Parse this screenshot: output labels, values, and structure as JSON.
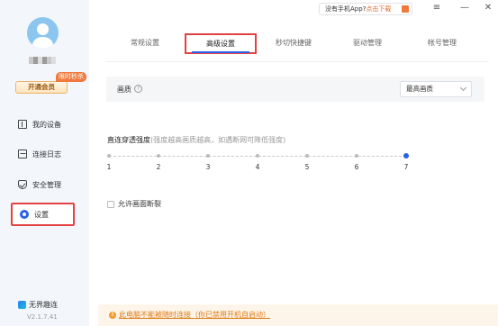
{
  "window": {
    "promo_text": "没有手机App?",
    "promo_link": "点击下载",
    "menu_icon": "≡",
    "minimize_icon": "—",
    "close_icon": "✕"
  },
  "sidebar": {
    "vip_button": "开通会员",
    "flash_badge": "限时秒杀",
    "items": [
      {
        "label": "我的设备",
        "icon": "device-icon"
      },
      {
        "label": "连接日志",
        "icon": "log-icon"
      },
      {
        "label": "安全管理",
        "icon": "shield-icon"
      },
      {
        "label": "设置",
        "icon": "gear-icon",
        "active": true
      }
    ],
    "brand": "无界趣连",
    "version": "V2.1.7.41"
  },
  "tabs": [
    {
      "label": "常规设置"
    },
    {
      "label": "高级设置",
      "active": true
    },
    {
      "label": "秒切快捷键"
    },
    {
      "label": "驱动管理"
    },
    {
      "label": "帐号管理"
    }
  ],
  "quality": {
    "label": "画质",
    "help_icon": "?",
    "selected": "最高画质"
  },
  "penetration": {
    "label": "直连穿透强度",
    "hint": "(强度越高画质越高，如遇断网可降低强度)",
    "ticks": [
      "1",
      "2",
      "3",
      "4",
      "5",
      "6",
      "7"
    ],
    "value": 7
  },
  "allow_break": {
    "label": "允许画面断裂",
    "checked": false
  },
  "warning": {
    "icon": "!",
    "text": "此电脑不能被随时连接（你已禁用开机自启动）"
  },
  "colors": {
    "accent": "#2a62e6",
    "highlight_border": "#e44242",
    "warning": "#e07a15"
  }
}
